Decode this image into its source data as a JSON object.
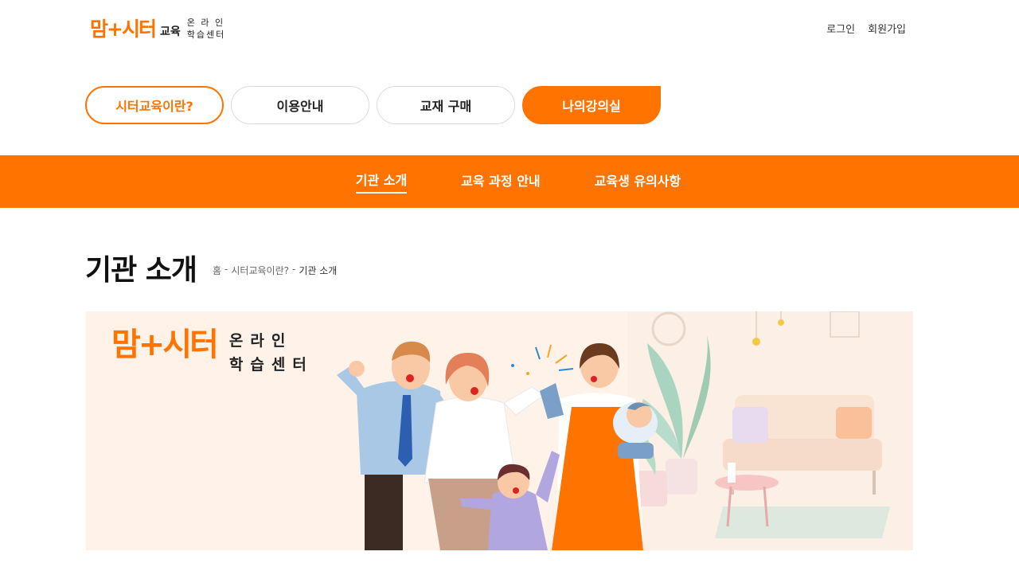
{
  "header": {
    "logo_mark": "맘+시터",
    "logo_edu": "교육",
    "logo_sub_line1": "온 라 인",
    "logo_sub_line2": "학습센터",
    "login": "로그인",
    "signup": "회원가입"
  },
  "gnb": {
    "items": [
      {
        "label": "시터교육이란?"
      },
      {
        "label": "이용안내"
      },
      {
        "label": "교재 구매"
      },
      {
        "label": "나의강의실"
      }
    ]
  },
  "subnav": {
    "items": [
      {
        "label": "기관 소개"
      },
      {
        "label": "교육 과정 안내"
      },
      {
        "label": "교육생 유의사항"
      }
    ]
  },
  "page": {
    "title": "기관 소개",
    "breadcrumb": [
      "홈",
      "-",
      "시터교육이란?",
      "-",
      "기관 소개"
    ]
  },
  "banner": {
    "logo_mark": "맘+시터",
    "sub_line1": "온라인",
    "sub_line2": "학습센터"
  },
  "colors": {
    "accent": "#ff7300",
    "banner_bg": "#fff2e8"
  }
}
